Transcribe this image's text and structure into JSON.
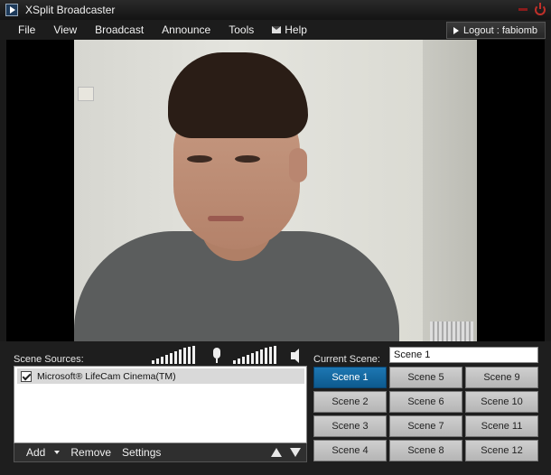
{
  "window": {
    "title": "XSplit Broadcaster"
  },
  "menu": {
    "items": [
      "File",
      "View",
      "Broadcast",
      "Announce",
      "Tools"
    ],
    "help": "Help",
    "logout": "Logout : fabiomb"
  },
  "sources": {
    "label": "Scene Sources:",
    "items": [
      {
        "name": "Microsoft® LifeCam Cinema(TM)",
        "checked": true
      }
    ],
    "toolbar": {
      "add": "Add",
      "remove": "Remove",
      "settings": "Settings"
    }
  },
  "audio": {
    "mic_level": 1.0,
    "speaker_level": 1.0
  },
  "scene": {
    "label": "Current Scene:",
    "current_value": "Scene 1",
    "buttons": [
      [
        "Scene 1",
        "Scene 5",
        "Scene 9"
      ],
      [
        "Scene 2",
        "Scene 6",
        "Scene 10"
      ],
      [
        "Scene 3",
        "Scene 7",
        "Scene 11"
      ],
      [
        "Scene 4",
        "Scene 8",
        "Scene 12"
      ]
    ],
    "active": "Scene 1",
    "active_color": "#0d5a8e"
  },
  "icons": [
    "app-icon",
    "minimize-icon",
    "power-icon",
    "mail-icon",
    "logout-arrow-icon",
    "microphone-icon",
    "speaker-icon",
    "move-up-icon",
    "move-down-icon",
    "dropdown-caret-icon",
    "checkbox-icon"
  ]
}
